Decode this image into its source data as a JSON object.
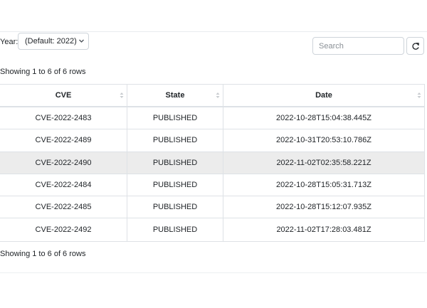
{
  "filter": {
    "year_label": "Year:",
    "year_value": "(Default: 2022)"
  },
  "search": {
    "placeholder": "Search"
  },
  "info": {
    "top": "Showing 1 to 6 of 6 rows",
    "bottom": "Showing 1 to 6 of 6 rows"
  },
  "table": {
    "columns": [
      "CVE",
      "State",
      "Date"
    ],
    "rows": [
      {
        "cve": "CVE-2022-2483",
        "state": "PUBLISHED",
        "date": "2022-10-28T15:04:38.445Z"
      },
      {
        "cve": "CVE-2022-2489",
        "state": "PUBLISHED",
        "date": "2022-10-31T20:53:10.786Z"
      },
      {
        "cve": "CVE-2022-2490",
        "state": "PUBLISHED",
        "date": "2022-11-02T02:35:58.221Z"
      },
      {
        "cve": "CVE-2022-2484",
        "state": "PUBLISHED",
        "date": "2022-10-28T15:05:31.713Z"
      },
      {
        "cve": "CVE-2022-2485",
        "state": "PUBLISHED",
        "date": "2022-10-28T15:12:07.935Z"
      },
      {
        "cve": "CVE-2022-2492",
        "state": "PUBLISHED",
        "date": "2022-11-02T17:28:03.481Z"
      }
    ],
    "hovered_row": 2
  },
  "icons": {
    "year_dropdown": "chevron-down-icon",
    "refresh": "refresh-icon",
    "sort": "sort-icon"
  },
  "colors": {
    "border": "#dee2e6",
    "hover_row": "#ececec"
  }
}
